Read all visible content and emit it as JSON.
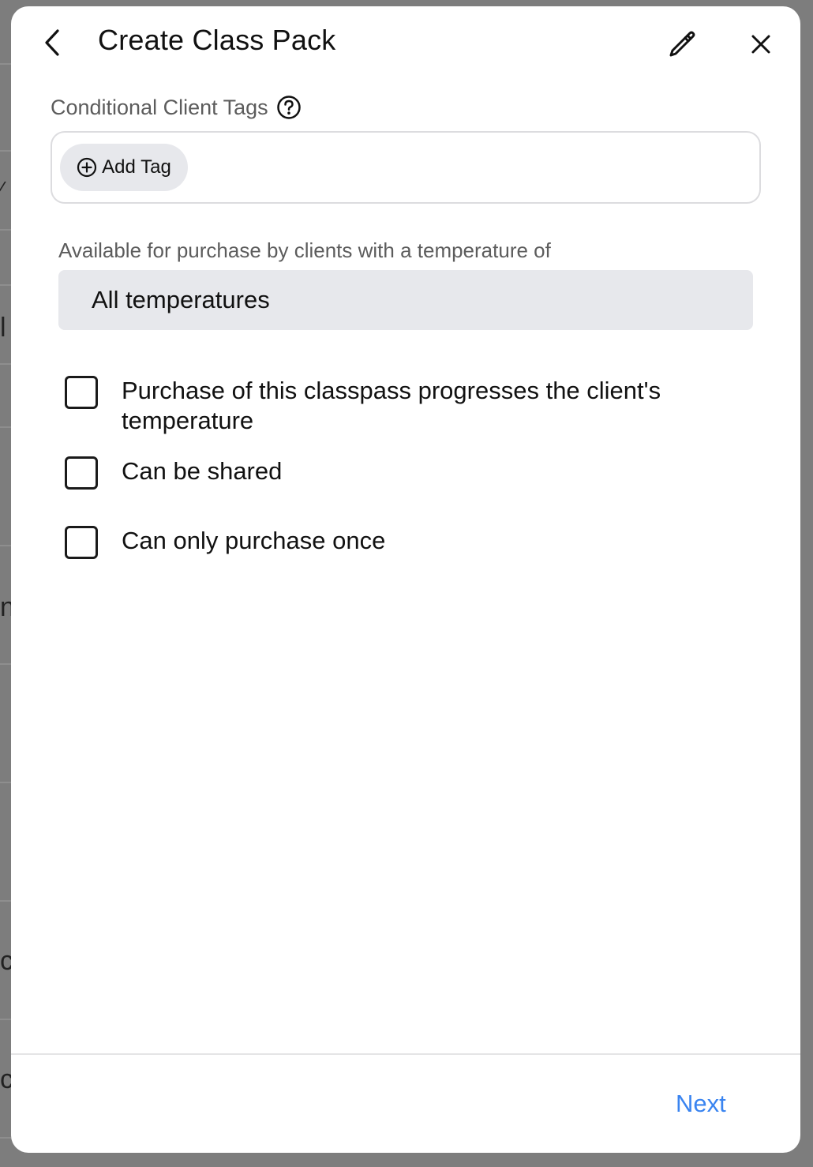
{
  "dialog": {
    "title": "Create Class Pack",
    "back_icon": "chevron-left-icon",
    "edit_icon": "pencil-icon",
    "close_icon": "close-icon"
  },
  "tags": {
    "label": "Conditional Client Tags",
    "help_icon": "question-circle-icon",
    "add_tag_label": "Add Tag",
    "add_tag_icon": "plus-circle-icon"
  },
  "temperature": {
    "label": "Available for purchase by clients with a temperature of",
    "selected": "All temperatures"
  },
  "options": [
    {
      "label": "Purchase of this classpass progresses the client's temperature",
      "checked": false
    },
    {
      "label": "Can be shared",
      "checked": false
    },
    {
      "label": "Can only purchase once",
      "checked": false
    }
  ],
  "footer": {
    "next_label": "Next",
    "next_color": "#3a84f0"
  },
  "background": {
    "fragments": [
      "⁄",
      "l",
      "n",
      "cl",
      "cl"
    ]
  }
}
